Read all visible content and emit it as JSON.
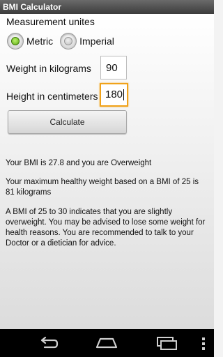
{
  "app": {
    "title": "BMI Calculator"
  },
  "units": {
    "label": "Measurement unites",
    "options": [
      {
        "label": "Metric",
        "selected": true
      },
      {
        "label": "Imperial",
        "selected": false
      }
    ]
  },
  "weight": {
    "label": "Weight in kilograms",
    "value": "90"
  },
  "height": {
    "label": "Height in centimeters",
    "value": "180"
  },
  "calculate_label": "Calculate",
  "results": {
    "bmi_text": "Your BMI is 27.8 and you are Overweight",
    "healthy_text": "Your maximum healthy weight based on a BMI of 25 is 81 kilograms",
    "advice_text": "A BMI of 25 to 30 indicates that you are slightly overweight. You may be advised to lose some weight for health reasons. You are recommended to talk to your Doctor or a dietician for advice."
  },
  "navbar": {
    "icons": [
      "back-icon",
      "home-icon",
      "recent-apps-icon",
      "menu-icon"
    ]
  },
  "colors": {
    "focus_accent": "#f0a21a",
    "radio_checked": "#5ea812",
    "titlebar": "#4a4a4a"
  }
}
